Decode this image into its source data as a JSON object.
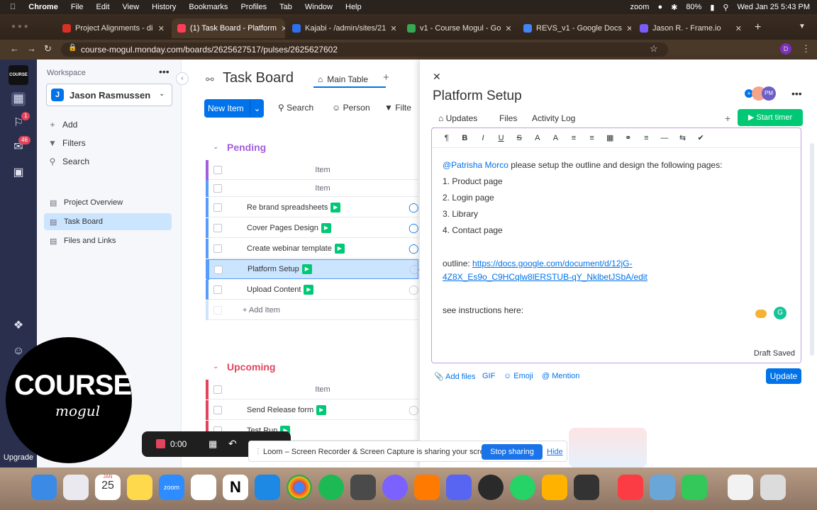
{
  "menubar": {
    "app": "Chrome",
    "items": [
      "File",
      "Edit",
      "View",
      "History",
      "Bookmarks",
      "Profiles",
      "Tab",
      "Window",
      "Help"
    ],
    "zoom": "zoom",
    "battery": "80%",
    "datetime": "Wed Jan 25  5:43 PM"
  },
  "tabs": [
    {
      "label": "Project Alignments - di",
      "color": "#d93025"
    },
    {
      "label": "(1) Task Board - Platform",
      "color": "#ff3d57"
    },
    {
      "label": "Kajabi - /admin/sites/21",
      "color": "#2e6ff2"
    },
    {
      "label": "v1 - Course Mogul - Go",
      "color": "#34a853"
    },
    {
      "label": "REVS_v1 - Google Docs",
      "color": "#4285f4"
    },
    {
      "label": "Jason R. - Frame.io",
      "color": "#7b5cfa"
    }
  ],
  "address": {
    "url": "course-mogul.monday.com/boards/2625627517/pulses/2625627602"
  },
  "rail": {
    "notif_badge": "1",
    "inbox_badge": "46",
    "upgrade": "Upgrade",
    "logo": "COURSE"
  },
  "workspace": {
    "label": "Workspace",
    "avatar": "J",
    "name": "Jason Rasmussen",
    "actions": [
      "Add",
      "Filters",
      "Search"
    ],
    "boards": [
      "Project Overview",
      "Task Board",
      "Files and Links"
    ]
  },
  "board": {
    "title": "Task Board",
    "view_tab": "Main Table",
    "new_item": "New Item",
    "search": "Search",
    "person": "Person",
    "filter": "Filte",
    "groups": [
      {
        "title": "Pending",
        "color": "#a25ddc",
        "header": "Item",
        "subheader": "Item",
        "items": [
          "Re brand spreadsheets",
          "Cover Pages Design",
          "Create webinar template",
          "Platform Setup",
          "Upload Content"
        ],
        "add_item": "+ Add Item"
      },
      {
        "title": "Upcoming",
        "color": "#e2445c",
        "header": "Item",
        "items": [
          "Send Release form",
          "Test Run"
        ]
      }
    ]
  },
  "panel": {
    "title": "Platform Setup",
    "tabs": [
      "Updates",
      "Files",
      "Activity Log"
    ],
    "start_timer": "Start timer",
    "toolbar": [
      "¶",
      "B",
      "I",
      "U",
      "S",
      "A",
      "A",
      "≡",
      "≡",
      "▦",
      "⚭",
      "≡",
      "—",
      "⇆",
      "✔"
    ],
    "mention": "@Patrisha Morco",
    "intro": " please setup the outline and design the following pages:",
    "list": [
      "1. Product page",
      "2. Login page",
      "3. Library",
      "4. Contact page"
    ],
    "outline_label": "outline: ",
    "outline_link_1": "https://docs.google.com/document/d/12jG-",
    "outline_link_2": "4Z8X_Es9o_C9HCqlw8lERSTUB-qY_NklbetJSbA/edit",
    "instructions": "see instructions here:",
    "draft": "Draft Saved",
    "footer": [
      "Add files",
      "GIF",
      "Emoji",
      "Mention"
    ],
    "update_btn": "Update"
  },
  "loom": {
    "time": "0:00",
    "toast": "Loom – Screen Recorder & Screen Capture is sharing your screen.",
    "stop": "Stop sharing",
    "hide": "Hide"
  },
  "dock": {
    "date_month": "JAN",
    "date_day": "25",
    "zoom_label": "zoom"
  }
}
